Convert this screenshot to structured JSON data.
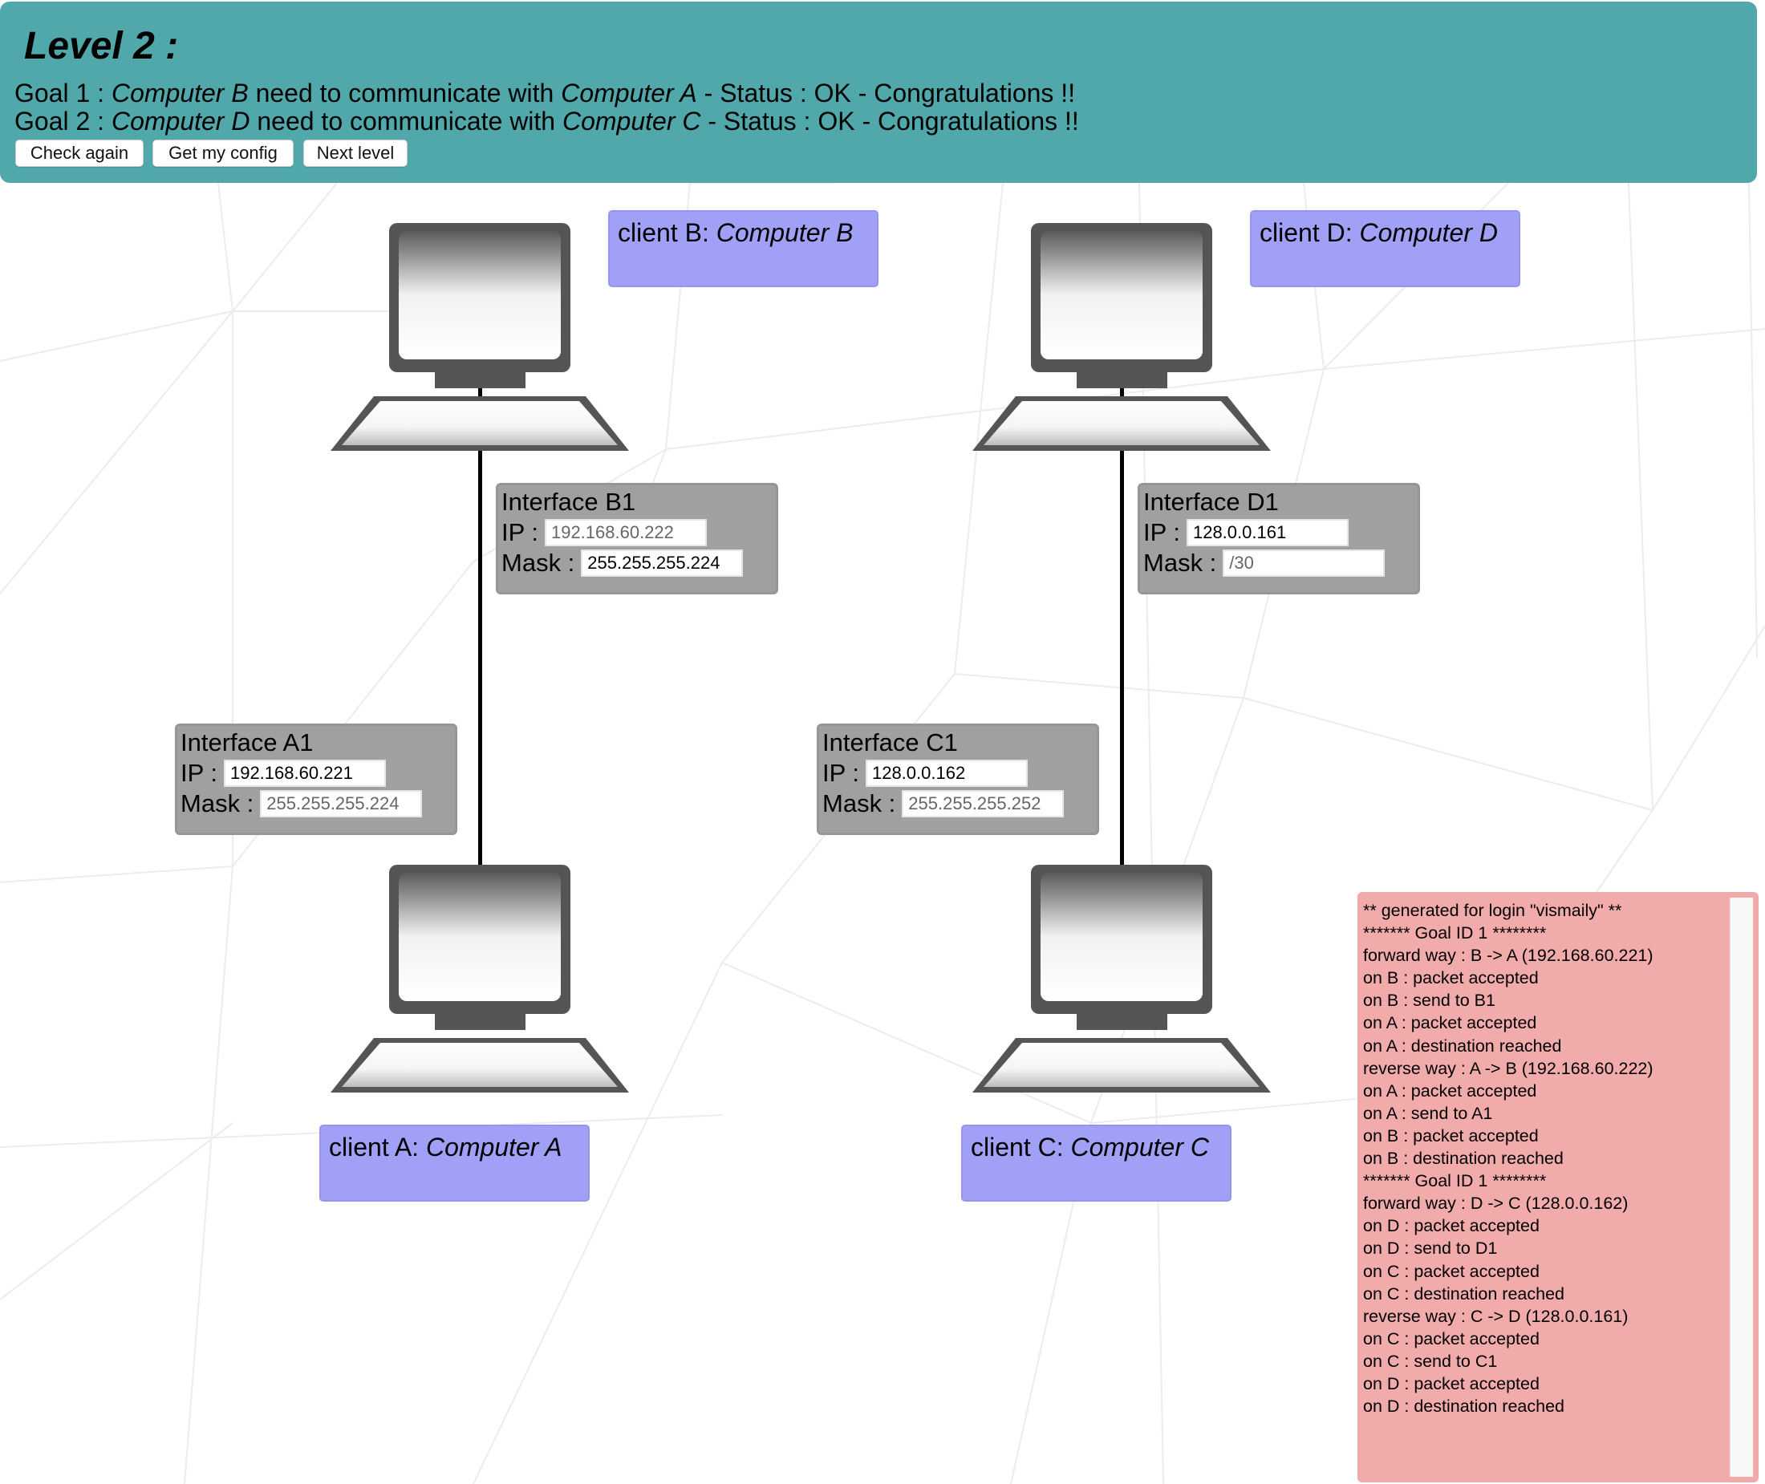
{
  "header": {
    "title": "Level 2 :",
    "goals": [
      {
        "prefix": "Goal 1 : ",
        "source": "Computer B",
        "middle": " need to communicate with ",
        "target": "Computer A",
        "suffix": " - Status : OK - Congratulations !!"
      },
      {
        "prefix": "Goal 2 : ",
        "source": "Computer D",
        "middle": " need to communicate with ",
        "target": "Computer C",
        "suffix": " - Status : OK - Congratulations !!"
      }
    ],
    "buttons": {
      "check_again": "Check again",
      "get_config": "Get my config",
      "next_level": "Next level"
    }
  },
  "clients": {
    "A": {
      "prefix": "client A: ",
      "name": "Computer A"
    },
    "B": {
      "prefix": "client B: ",
      "name": "Computer B"
    },
    "C": {
      "prefix": "client C: ",
      "name": "Computer C"
    },
    "D": {
      "prefix": "client D: ",
      "name": "Computer D"
    }
  },
  "interfaces": {
    "B1": {
      "title": "Interface B1",
      "ip_label": "IP :",
      "mask_label": "Mask :",
      "ip_value": "",
      "ip_placeholder": "192.168.60.222",
      "mask_value": "255.255.255.224",
      "mask_placeholder": ""
    },
    "D1": {
      "title": "Interface D1",
      "ip_label": "IP :",
      "mask_label": "Mask :",
      "ip_value": "128.0.0.161",
      "ip_placeholder": "",
      "mask_value": "",
      "mask_placeholder": "/30"
    },
    "A1": {
      "title": "Interface A1",
      "ip_label": "IP :",
      "mask_label": "Mask :",
      "ip_value": "192.168.60.221",
      "ip_placeholder": "",
      "mask_value": "",
      "mask_placeholder": "255.255.255.224"
    },
    "C1": {
      "title": "Interface C1",
      "ip_label": "IP :",
      "mask_label": "Mask :",
      "ip_value": "128.0.0.162",
      "ip_placeholder": "",
      "mask_value": "",
      "mask_placeholder": "255.255.255.252"
    }
  },
  "log": {
    "lines": [
      "** generated for login \"vismaily\" **",
      "******* Goal ID 1 ********",
      "forward way : B -> A (192.168.60.221)",
      "on B : packet accepted",
      "on B : send to B1",
      "on A : packet accepted",
      "on A : destination reached",
      "reverse way : A -> B (192.168.60.222)",
      "on A : packet accepted",
      "on A : send to A1",
      "on B : packet accepted",
      "on B : destination reached",
      "******* Goal ID 1 ********",
      "forward way : D -> C (128.0.0.162)",
      "on D : packet accepted",
      "on D : send to D1",
      "on C : packet accepted",
      "on C : destination reached",
      "reverse way : C -> D (128.0.0.161)",
      "on C : packet accepted",
      "on C : send to C1",
      "on D : packet accepted",
      "on D : destination reached"
    ]
  },
  "colors": {
    "header_bg": "#50a8ab",
    "client_box": "#a0a0f6",
    "interface_box": "#a0a0a0",
    "log_bg": "#f1abab"
  }
}
